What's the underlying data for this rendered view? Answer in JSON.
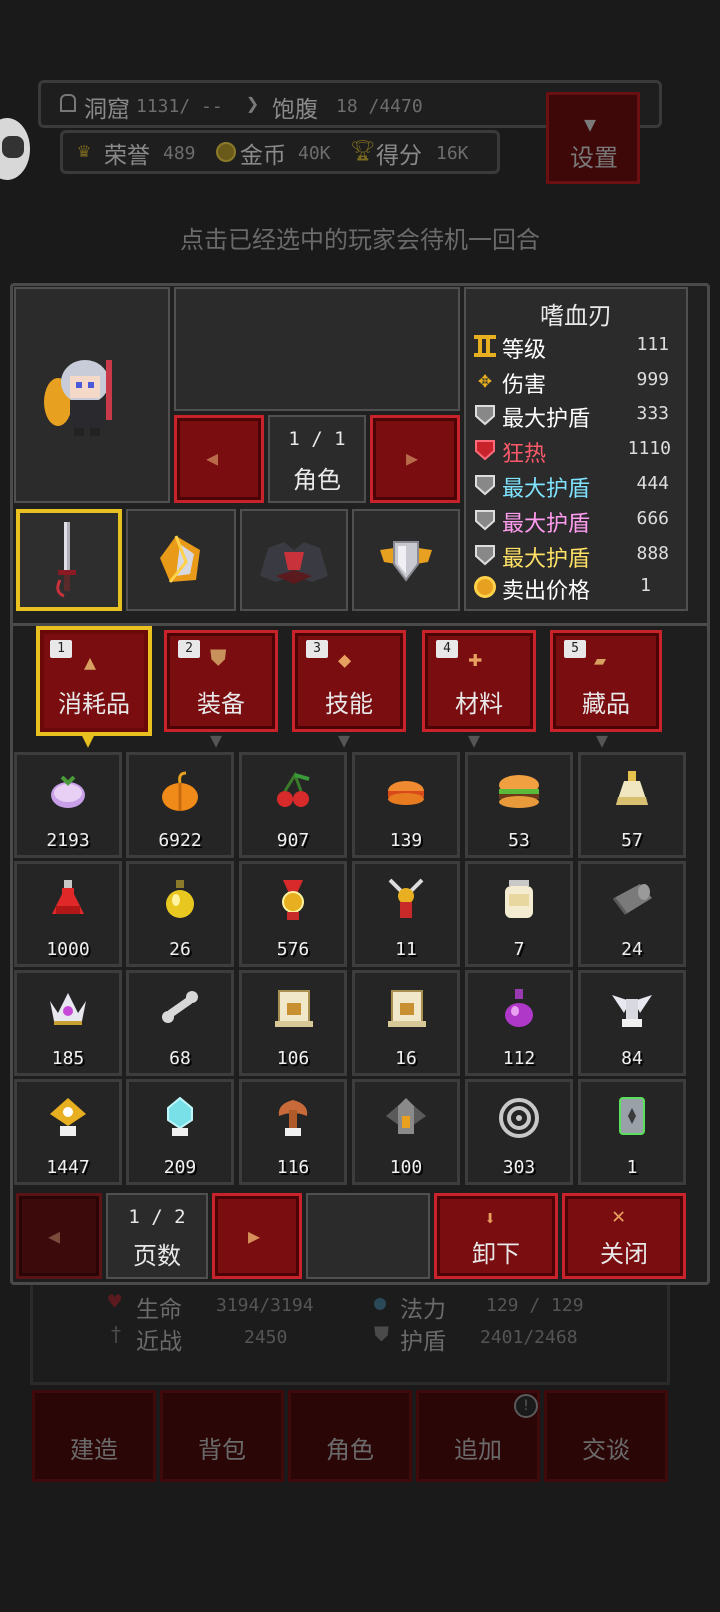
{
  "top": {
    "cave_label": "洞窟",
    "cave_value": "1131/ --",
    "satiety_label": "饱腹",
    "satiety_value": "18 /4470",
    "honor_label": "荣誉",
    "honor_value": "489",
    "gold_label": "金币",
    "gold_value": "40K",
    "score_label": "得分",
    "score_value": "16K",
    "settings_label": "设置"
  },
  "hint": "点击已经选中的玩家会待机一回合",
  "character": {
    "page": "1 / 1",
    "page_label": "角色"
  },
  "item_detail": {
    "name": "嗜血刃",
    "stats": [
      {
        "label": "等级",
        "value": "111",
        "color": "#ffffff",
        "icon": "level-icon"
      },
      {
        "label": "伤害",
        "value": "999",
        "color": "#ffffff",
        "icon": "damage-icon"
      },
      {
        "label": "最大护盾",
        "value": "333",
        "color": "#ffffff",
        "icon": "shield-icon"
      },
      {
        "label": "狂热",
        "value": "1110",
        "color": "#ff5a6a",
        "icon": "frenzy-icon"
      },
      {
        "label": "最大护盾",
        "value": "444",
        "color": "#7fe3ff",
        "icon": "shield-icon"
      },
      {
        "label": "最大护盾",
        "value": "666",
        "color": "#ff9cf0",
        "icon": "shield-icon"
      },
      {
        "label": "最大护盾",
        "value": "888",
        "color": "#ffe066",
        "icon": "shield-icon"
      },
      {
        "label": "卖出价格",
        "value": "1",
        "color": "#ffffff",
        "icon": "coin-icon"
      }
    ]
  },
  "tabs": [
    {
      "num": "1",
      "label": "消耗品"
    },
    {
      "num": "2",
      "label": "装备"
    },
    {
      "num": "3",
      "label": "技能"
    },
    {
      "num": "4",
      "label": "材料"
    },
    {
      "num": "5",
      "label": "藏品"
    }
  ],
  "items": [
    {
      "count": "2193",
      "icon": "turnip-icon"
    },
    {
      "count": "6922",
      "icon": "pumpkin-icon"
    },
    {
      "count": "907",
      "icon": "cherries-icon"
    },
    {
      "count": "139",
      "icon": "bun-icon"
    },
    {
      "count": "53",
      "icon": "burger-icon"
    },
    {
      "count": "57",
      "icon": "oil-flask-icon"
    },
    {
      "count": "1000",
      "icon": "red-potion-icon"
    },
    {
      "count": "26",
      "icon": "yellow-potion-icon"
    },
    {
      "count": "576",
      "icon": "medal-icon"
    },
    {
      "count": "11",
      "icon": "sword-medal-icon"
    },
    {
      "count": "7",
      "icon": "jar-icon"
    },
    {
      "count": "24",
      "icon": "scroll-roll-icon"
    },
    {
      "count": "185",
      "icon": "crown-icon"
    },
    {
      "count": "68",
      "icon": "bone-icon"
    },
    {
      "count": "106",
      "icon": "scroll-icon"
    },
    {
      "count": "16",
      "icon": "scroll-icon"
    },
    {
      "count": "112",
      "icon": "purple-potion-icon"
    },
    {
      "count": "84",
      "icon": "winged-statue-icon"
    },
    {
      "count": "1447",
      "icon": "gold-statue-icon"
    },
    {
      "count": "209",
      "icon": "crystal-statue-icon"
    },
    {
      "count": "116",
      "icon": "tree-statue-icon"
    },
    {
      "count": "100",
      "icon": "shrine-icon"
    },
    {
      "count": "303",
      "icon": "target-icon"
    },
    {
      "count": "1",
      "icon": "card-icon"
    }
  ],
  "pager": {
    "page": "1 / 2",
    "label": "页数"
  },
  "actions": {
    "unequip": "卸下",
    "close": "关闭"
  },
  "bg_stats": {
    "hp_label": "生命",
    "hp_value": "3194/3194",
    "mp_label": "法力",
    "mp_value": "129 / 129",
    "melee_label": "近战",
    "melee_value": "2450",
    "shield_label": "护盾",
    "shield_value": "2401/2468"
  },
  "bottom_nav": [
    "建造",
    "背包",
    "角色",
    "追加",
    "交谈"
  ]
}
